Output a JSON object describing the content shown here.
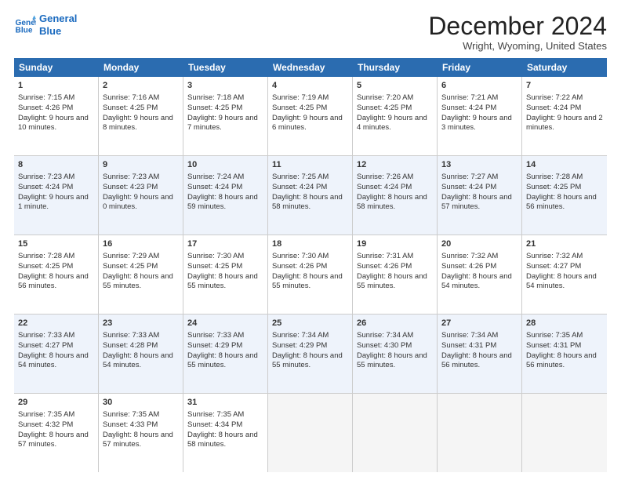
{
  "logo": {
    "line1": "General",
    "line2": "Blue"
  },
  "title": "December 2024",
  "subtitle": "Wright, Wyoming, United States",
  "days_of_week": [
    "Sunday",
    "Monday",
    "Tuesday",
    "Wednesday",
    "Thursday",
    "Friday",
    "Saturday"
  ],
  "weeks": [
    [
      {
        "day": 1,
        "sunrise": "7:15 AM",
        "sunset": "4:26 PM",
        "daylight": "9 hours and 10 minutes."
      },
      {
        "day": 2,
        "sunrise": "7:16 AM",
        "sunset": "4:25 PM",
        "daylight": "9 hours and 8 minutes."
      },
      {
        "day": 3,
        "sunrise": "7:18 AM",
        "sunset": "4:25 PM",
        "daylight": "9 hours and 7 minutes."
      },
      {
        "day": 4,
        "sunrise": "7:19 AM",
        "sunset": "4:25 PM",
        "daylight": "9 hours and 6 minutes."
      },
      {
        "day": 5,
        "sunrise": "7:20 AM",
        "sunset": "4:25 PM",
        "daylight": "9 hours and 4 minutes."
      },
      {
        "day": 6,
        "sunrise": "7:21 AM",
        "sunset": "4:24 PM",
        "daylight": "9 hours and 3 minutes."
      },
      {
        "day": 7,
        "sunrise": "7:22 AM",
        "sunset": "4:24 PM",
        "daylight": "9 hours and 2 minutes."
      }
    ],
    [
      {
        "day": 8,
        "sunrise": "7:23 AM",
        "sunset": "4:24 PM",
        "daylight": "9 hours and 1 minute."
      },
      {
        "day": 9,
        "sunrise": "7:23 AM",
        "sunset": "4:23 PM",
        "daylight": "9 hours and 0 minutes."
      },
      {
        "day": 10,
        "sunrise": "7:24 AM",
        "sunset": "4:24 PM",
        "daylight": "8 hours and 59 minutes."
      },
      {
        "day": 11,
        "sunrise": "7:25 AM",
        "sunset": "4:24 PM",
        "daylight": "8 hours and 58 minutes."
      },
      {
        "day": 12,
        "sunrise": "7:26 AM",
        "sunset": "4:24 PM",
        "daylight": "8 hours and 58 minutes."
      },
      {
        "day": 13,
        "sunrise": "7:27 AM",
        "sunset": "4:24 PM",
        "daylight": "8 hours and 57 minutes."
      },
      {
        "day": 14,
        "sunrise": "7:28 AM",
        "sunset": "4:25 PM",
        "daylight": "8 hours and 56 minutes."
      }
    ],
    [
      {
        "day": 15,
        "sunrise": "7:28 AM",
        "sunset": "4:25 PM",
        "daylight": "8 hours and 56 minutes."
      },
      {
        "day": 16,
        "sunrise": "7:29 AM",
        "sunset": "4:25 PM",
        "daylight": "8 hours and 55 minutes."
      },
      {
        "day": 17,
        "sunrise": "7:30 AM",
        "sunset": "4:25 PM",
        "daylight": "8 hours and 55 minutes."
      },
      {
        "day": 18,
        "sunrise": "7:30 AM",
        "sunset": "4:26 PM",
        "daylight": "8 hours and 55 minutes."
      },
      {
        "day": 19,
        "sunrise": "7:31 AM",
        "sunset": "4:26 PM",
        "daylight": "8 hours and 55 minutes."
      },
      {
        "day": 20,
        "sunrise": "7:32 AM",
        "sunset": "4:26 PM",
        "daylight": "8 hours and 54 minutes."
      },
      {
        "day": 21,
        "sunrise": "7:32 AM",
        "sunset": "4:27 PM",
        "daylight": "8 hours and 54 minutes."
      }
    ],
    [
      {
        "day": 22,
        "sunrise": "7:33 AM",
        "sunset": "4:27 PM",
        "daylight": "8 hours and 54 minutes."
      },
      {
        "day": 23,
        "sunrise": "7:33 AM",
        "sunset": "4:28 PM",
        "daylight": "8 hours and 54 minutes."
      },
      {
        "day": 24,
        "sunrise": "7:33 AM",
        "sunset": "4:29 PM",
        "daylight": "8 hours and 55 minutes."
      },
      {
        "day": 25,
        "sunrise": "7:34 AM",
        "sunset": "4:29 PM",
        "daylight": "8 hours and 55 minutes."
      },
      {
        "day": 26,
        "sunrise": "7:34 AM",
        "sunset": "4:30 PM",
        "daylight": "8 hours and 55 minutes."
      },
      {
        "day": 27,
        "sunrise": "7:34 AM",
        "sunset": "4:31 PM",
        "daylight": "8 hours and 56 minutes."
      },
      {
        "day": 28,
        "sunrise": "7:35 AM",
        "sunset": "4:31 PM",
        "daylight": "8 hours and 56 minutes."
      }
    ],
    [
      {
        "day": 29,
        "sunrise": "7:35 AM",
        "sunset": "4:32 PM",
        "daylight": "8 hours and 57 minutes."
      },
      {
        "day": 30,
        "sunrise": "7:35 AM",
        "sunset": "4:33 PM",
        "daylight": "8 hours and 57 minutes."
      },
      {
        "day": 31,
        "sunrise": "7:35 AM",
        "sunset": "4:34 PM",
        "daylight": "8 hours and 58 minutes."
      },
      null,
      null,
      null,
      null
    ]
  ]
}
